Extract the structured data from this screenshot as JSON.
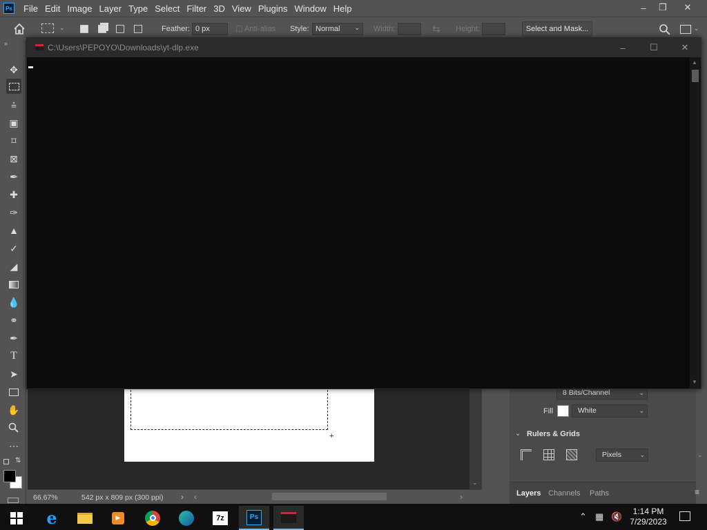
{
  "app": {
    "menu": [
      "File",
      "Edit",
      "Image",
      "Layer",
      "Type",
      "Select",
      "Filter",
      "3D",
      "View",
      "Plugins",
      "Window",
      "Help"
    ],
    "logo_text": "Ps"
  },
  "options_bar": {
    "feather_label": "Feather:",
    "feather_value": "0 px",
    "antialias_label": "Anti-alias",
    "style_label": "Style:",
    "style_value": "Normal",
    "width_label": "Width:",
    "height_label": "Height:",
    "select_mask_label": "Select and Mask..."
  },
  "console": {
    "title": "C:\\Users\\PEPOYO\\Downloads\\yt-dlp.exe"
  },
  "status": {
    "zoom": "66.67%",
    "doc_info": "542 px x 809 px (300 ppi)"
  },
  "properties": {
    "bit_depth": "8 Bits/Channel",
    "fill_label": "Fill",
    "fill_value": "White",
    "rulers_title": "Rulers & Grids",
    "units_value": "Pixels"
  },
  "panel_tabs": [
    "Layers",
    "Channels",
    "Paths"
  ],
  "taskbar": {
    "time": "1:14 PM",
    "date": "7/29/2023"
  },
  "colors": {
    "foreground": "#000000",
    "background": "#ffffff",
    "ps_accent": "#31a8ff"
  }
}
